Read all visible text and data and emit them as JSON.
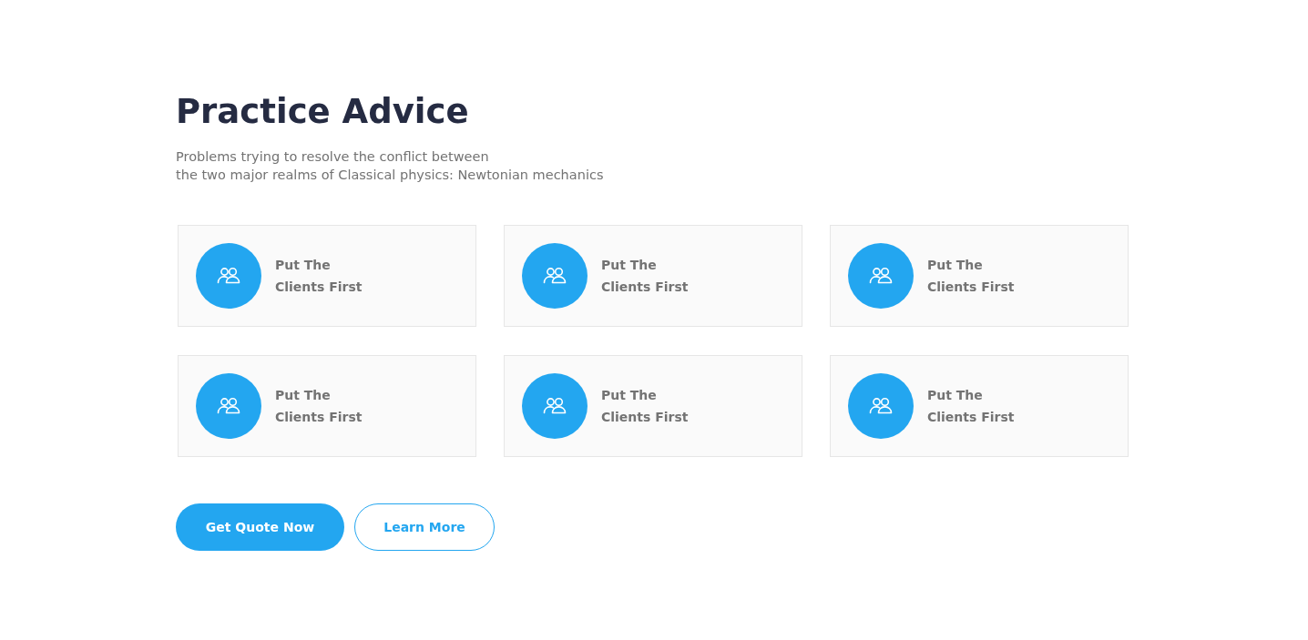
{
  "heading": "Practice Advice",
  "description": {
    "lines": [
      "Problems trying to resolve the conflict between",
      "the two major realms of Classical physics: Newtonian mechanics"
    ]
  },
  "cards": [
    {
      "title_lines": [
        "Put The",
        "Clients First"
      ]
    },
    {
      "title_lines": [
        "Put The",
        "Clients First"
      ]
    },
    {
      "title_lines": [
        "Put The",
        "Clients First"
      ]
    },
    {
      "title_lines": [
        "Put The",
        "Clients First"
      ]
    },
    {
      "title_lines": [
        "Put The",
        "Clients First"
      ]
    },
    {
      "title_lines": [
        "Put The",
        "Clients First"
      ]
    }
  ],
  "buttons": [
    {
      "label": "Get Quote Now",
      "kind": "primary"
    },
    {
      "label": "Learn More",
      "kind": "outline"
    }
  ]
}
